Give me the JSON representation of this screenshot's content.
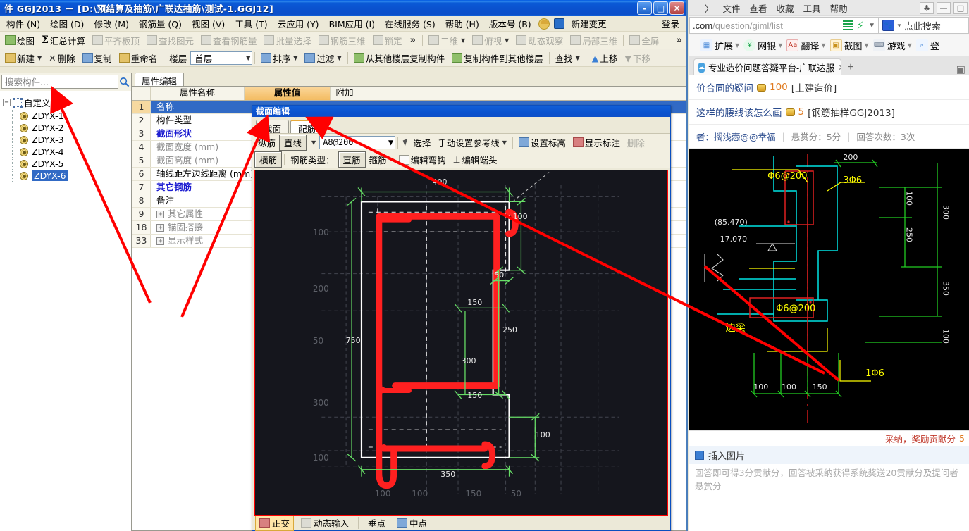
{
  "app": {
    "title": "件 GGJ2013 － [D:\\预结算及抽筋\\广联达抽筋\\测试-1.GGJ12]",
    "window_buttons": {
      "minimize": "–",
      "maximize": "□",
      "close": "✕"
    },
    "menu": [
      "构件 (N)",
      "绘图 (D)",
      "修改 (M)",
      "钢筋量 (Q)",
      "视图 (V)",
      "工具 (T)",
      "云应用 (Y)",
      "BIM应用 (I)",
      "在线服务 (S)",
      "帮助 (H)",
      "版本号 (B)"
    ],
    "menu_extra": "新建变更",
    "login": "登录",
    "toolbar1": [
      {
        "label": "绘图",
        "disabled": false
      },
      {
        "label": "汇总计算",
        "disabled": false
      },
      {
        "label": "平齐板顶",
        "disabled": true
      },
      {
        "label": "查找图元",
        "disabled": true
      },
      {
        "label": "查看钢筋量",
        "disabled": true
      },
      {
        "label": "批量选择",
        "disabled": true
      },
      {
        "label": "钢筋三维",
        "disabled": true
      },
      {
        "label": "锁定",
        "disabled": true
      }
    ],
    "toolbar1_right": [
      {
        "label": "二维",
        "disabled": true
      },
      {
        "label": "俯视",
        "disabled": true
      },
      {
        "label": "动态观察",
        "disabled": true
      },
      {
        "label": "局部三维",
        "disabled": true
      },
      {
        "label": "全屏",
        "disabled": true
      }
    ],
    "toolbar2": [
      {
        "label": "新建",
        "caret": true
      },
      {
        "label": "删除",
        "caret": false
      },
      {
        "label": "复制",
        "caret": false
      },
      {
        "label": "重命名",
        "caret": false
      }
    ],
    "floor_label": "楼层",
    "floor_value": "首层",
    "toolbar2b": [
      {
        "label": "排序",
        "caret": true
      },
      {
        "label": "过滤",
        "caret": true
      },
      {
        "label": "从其他楼层复制构件",
        "caret": false
      },
      {
        "label": "复制构件到其他楼层",
        "caret": false
      },
      {
        "label": "查找",
        "caret": true
      },
      {
        "label": "上移",
        "caret": false
      },
      {
        "label": "下移",
        "caret": false,
        "disabled": true
      }
    ]
  },
  "tree": {
    "search_placeholder": "搜索构件...",
    "root": "自定义线",
    "items": [
      "ZDYX-1",
      "ZDYX-2",
      "ZDYX-3",
      "ZDYX-4",
      "ZDYX-5",
      "ZDYX-6"
    ],
    "selected": "ZDYX-6"
  },
  "properties": {
    "tab": "属性编辑",
    "headers": {
      "index": "",
      "name": "属性名称",
      "value": "属性值",
      "extra": "附加"
    },
    "rows": [
      {
        "n": "1",
        "label": "名称",
        "style": "selected"
      },
      {
        "n": "2",
        "label": "构件类型",
        "style": "normal"
      },
      {
        "n": "3",
        "label": "截面形状",
        "style": "blue"
      },
      {
        "n": "4",
        "label": "截面宽度 (mm)",
        "style": "grey"
      },
      {
        "n": "5",
        "label": "截面高度 (mm)",
        "style": "grey"
      },
      {
        "n": "6",
        "label": "轴线距左边线距离 (mm)",
        "style": "normal"
      },
      {
        "n": "7",
        "label": "其它钢筋",
        "style": "blue"
      },
      {
        "n": "8",
        "label": "备注",
        "style": "normal"
      },
      {
        "n": "9",
        "label": "其它属性",
        "style": "grey",
        "expand": "+"
      },
      {
        "n": "18",
        "label": "锚固搭接",
        "style": "grey",
        "expand": "+"
      },
      {
        "n": "33",
        "label": "显示样式",
        "style": "grey",
        "expand": "+"
      }
    ]
  },
  "section_dialog": {
    "title": "截面编辑",
    "tabs": [
      {
        "label": "截面",
        "active": false
      },
      {
        "label": "配筋",
        "active": true
      }
    ],
    "toolbar_row1": {
      "mode_label": "纵筋",
      "shape_button": "直线",
      "rebar_spec": "A8@200",
      "select": "选择",
      "ref_line": "手动设置参考线",
      "set_elevation": "设置标高",
      "show_annotation": "显示标注",
      "delete": "删除"
    },
    "toolbar_row2": {
      "mode_label": "横筋",
      "type_label": "钢筋类型：",
      "type_straight": "直筋",
      "type_stirrup": "箍筋",
      "edit_hook": "编辑弯钩",
      "edit_end": "编辑端头"
    },
    "status_bar": [
      "正交",
      "动态输入",
      "垂点",
      "中点"
    ]
  },
  "cad_section": {
    "dimensions_top": [
      "400"
    ],
    "dimensions_right": [
      "100",
      "50",
      "250",
      "150",
      "300",
      "150",
      "100"
    ],
    "dimensions_bottom": [
      "350",
      "100",
      "100",
      "150",
      "50"
    ],
    "dimensions_left": [
      "750"
    ],
    "grid_labels_left": [
      "100",
      "200",
      "50",
      "300",
      "100"
    ]
  },
  "browser": {
    "menu": [
      "文件",
      "查看",
      "收藏",
      "工具",
      "帮助"
    ],
    "chevron": "〉",
    "url_domain": ".com",
    "url_path": "/question/giml/list",
    "search_placeholder": "点此搜索",
    "extensions": [
      {
        "label": "扩展",
        "caret": true
      },
      {
        "label": "网银",
        "caret": true
      },
      {
        "label": "翻译",
        "caret": true
      },
      {
        "label": "截图",
        "caret": true
      },
      {
        "label": "游戏",
        "caret": true
      },
      {
        "label": "登",
        "caret": false
      }
    ],
    "tab_title": "专业造价问题答疑平台-广联达服",
    "tab_close": "✕",
    "new_tab": "+",
    "questions": [
      {
        "text": "价合同的疑问",
        "points": "100",
        "category": "[土建造价]"
      },
      {
        "text": "这样的腰线该怎么画",
        "points": "5",
        "category": "[钢筋抽样GGJ2013]"
      }
    ],
    "meta": {
      "author_label": "者：搁浅悫@@幸福",
      "bounty": "悬赏分：5分",
      "answers": "回答次数：3次"
    },
    "adopt_text": "采纳，奖励贡献分",
    "adopt_num": "5",
    "insert_image": "插入图片",
    "hint": "回答即可得3分贡献分，回答被采纳获得系统奖送20贡献分及提问者悬赏分"
  },
  "cad_detail": {
    "labels": [
      "Φ6@200",
      "3Φ6",
      "Φ6@200",
      "1Φ6",
      "边梁",
      "(85.470)",
      "17.070",
      "200",
      "100",
      "250",
      "300",
      "350",
      "100",
      "100",
      "100",
      "150"
    ]
  },
  "colors": {
    "title_blue": "#0a52cf",
    "accent_orange": "#f3bc62",
    "selection_blue": "#316ac5",
    "cad_bg": "#15161d",
    "cad_red": "#ff2020",
    "cad_green": "#66dd66",
    "cad_white": "#ffffff",
    "cad_yellow": "#ffff00",
    "cad_cyan": "#00ffff",
    "annotation_red": "#ff0000"
  }
}
